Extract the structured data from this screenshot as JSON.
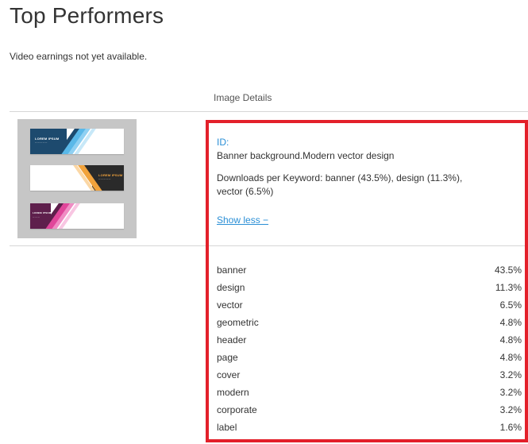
{
  "header": {
    "title": "Top Performers",
    "video_note": "Video earnings not yet available.",
    "column_header": "Image Details"
  },
  "image": {
    "id_label": "ID:",
    "title": "Banner background.Modern vector design",
    "downloads": "Downloads per Keyword: banner (43.5%), design (11.3%), vector (6.5%)",
    "toggle_label": "Show less −",
    "thumbnail_text": "LOREM IPSUM"
  },
  "keywords": [
    {
      "name": "banner",
      "pct": "43.5%"
    },
    {
      "name": "design",
      "pct": "11.3%"
    },
    {
      "name": "vector",
      "pct": "6.5%"
    },
    {
      "name": "geometric",
      "pct": "4.8%"
    },
    {
      "name": "header",
      "pct": "4.8%"
    },
    {
      "name": "page",
      "pct": "4.8%"
    },
    {
      "name": "cover",
      "pct": "3.2%"
    },
    {
      "name": "modern",
      "pct": "3.2%"
    },
    {
      "name": "corporate",
      "pct": "3.2%"
    },
    {
      "name": "label",
      "pct": "1.6%"
    }
  ],
  "colors": {
    "link": "#2a8fd6",
    "highlight_border": "#e3202a",
    "banner1_dark": "#1d4a6e",
    "banner1_accent": "#5ab8e8",
    "banner2_dark": "#2a2a2a",
    "banner2_accent": "#f2a33c",
    "banner3_dark": "#5e1f4c",
    "banner3_accent": "#e0469a"
  }
}
